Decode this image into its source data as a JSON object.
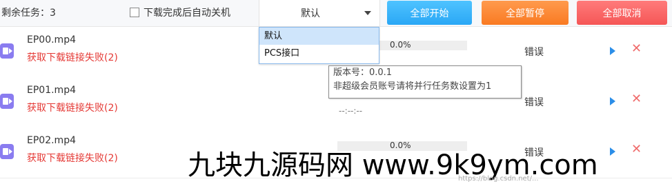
{
  "toolbar": {
    "remaining_label": "剩余任务：3",
    "auto_shutdown_label": "下载完成后自动关机",
    "auto_shutdown_checked": false,
    "mode_value": "默认",
    "start_all": "全部开始",
    "pause_all": "全部暂停",
    "cancel_all": "全部取消"
  },
  "dropdown": {
    "options": [
      "默认",
      "PCS接口"
    ],
    "highlighted": "默认"
  },
  "tooltip": {
    "line1": "版本号：0.0.1",
    "line2": "非超级会员账号请将并行任务数设置为1"
  },
  "tasks": [
    {
      "filename": "EP00.mp4",
      "error": "获取下载链接失败(2)",
      "progress": "0.0%",
      "speed": "",
      "status": "错误"
    },
    {
      "filename": "EP01.mp4",
      "error": "获取下载链接失败(2)",
      "progress": "",
      "speed": "--:--:--",
      "status": "错误"
    },
    {
      "filename": "EP02.mp4",
      "error": "获取下载链接失败(2)",
      "progress": "0.0%",
      "speed": "",
      "status": "错误"
    }
  ],
  "watermark": {
    "text": "九块九源码网 www.9k9ym.com",
    "url": "https://blog.csdn.net/..."
  }
}
